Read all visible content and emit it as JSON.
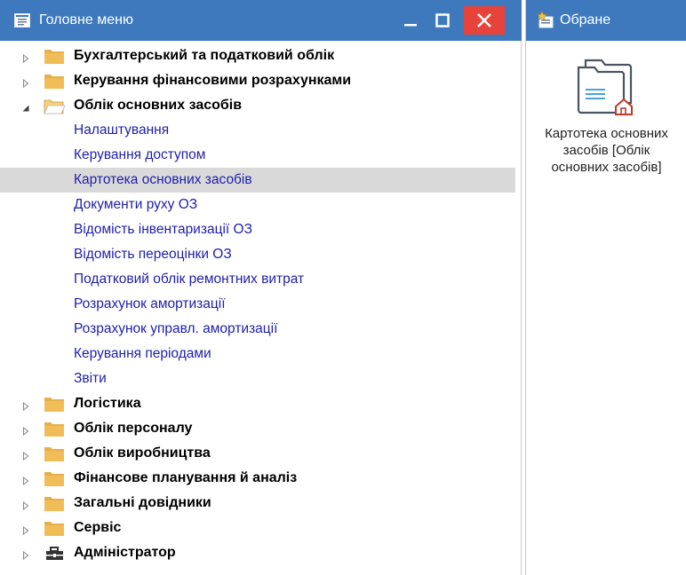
{
  "main_menu": {
    "title": "Головне меню",
    "items": [
      {
        "label": "Бухгалтерський та податковий облік",
        "type": "group",
        "expanded": false,
        "icon": "folder-icon"
      },
      {
        "label": "Керування фінансовими розрахунками",
        "type": "group",
        "expanded": false,
        "icon": "folder-icon"
      },
      {
        "label": "Облік основних засобів",
        "type": "group",
        "expanded": true,
        "icon": "folder-open-icon"
      },
      {
        "label": "Налаштування",
        "type": "link"
      },
      {
        "label": "Керування доступом",
        "type": "link"
      },
      {
        "label": "Картотека основних засобів",
        "type": "link",
        "selected": true
      },
      {
        "label": "Документи руху ОЗ",
        "type": "link"
      },
      {
        "label": "Відомість інвентаризації ОЗ",
        "type": "link"
      },
      {
        "label": "Відомість переоцінки ОЗ",
        "type": "link"
      },
      {
        "label": "Податковий облік ремонтних витрат",
        "type": "link"
      },
      {
        "label": "Розрахунок амортизації",
        "type": "link"
      },
      {
        "label": "Розрахунок управл. амортизації",
        "type": "link"
      },
      {
        "label": "Керування періодами",
        "type": "link"
      },
      {
        "label": "Звіти",
        "type": "link"
      },
      {
        "label": "Логістика",
        "type": "group",
        "expanded": false,
        "icon": "folder-icon"
      },
      {
        "label": "Облік персоналу",
        "type": "group",
        "expanded": false,
        "icon": "folder-icon"
      },
      {
        "label": "Облік виробництва",
        "type": "group",
        "expanded": false,
        "icon": "folder-icon"
      },
      {
        "label": "Фінансове планування й аналіз",
        "type": "group",
        "expanded": false,
        "icon": "folder-icon"
      },
      {
        "label": "Загальні довідники",
        "type": "group",
        "expanded": false,
        "icon": "folder-icon"
      },
      {
        "label": "Сервіс",
        "type": "group",
        "expanded": false,
        "icon": "folder-icon"
      },
      {
        "label": "Адміністратор",
        "type": "group",
        "expanded": false,
        "icon": "toolbox-icon"
      }
    ]
  },
  "favorites": {
    "title": "Обране",
    "tile_label": "Картотека основних засобів [Облік основних засобів]"
  },
  "colors": {
    "titlebar": "#3e79bd",
    "close_button": "#e8433a",
    "link_text": "#1f1fa8",
    "selected_row": "#d9d9d9",
    "folder": "#e8b04a"
  }
}
